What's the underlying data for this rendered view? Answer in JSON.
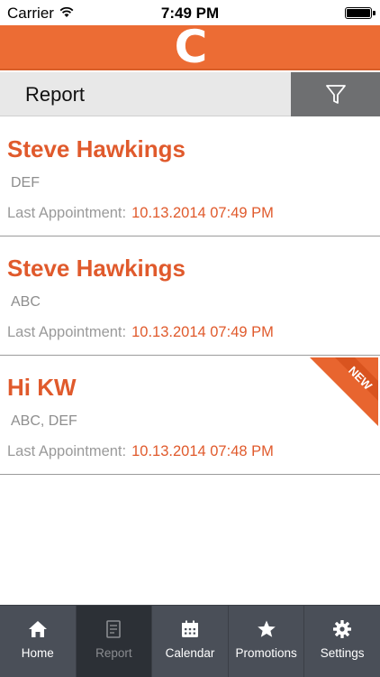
{
  "status_bar": {
    "carrier": "Carrier",
    "time": "7:49 PM",
    "battery_level": 1.0
  },
  "brand": {
    "logo_text": "C",
    "color": "#ec6c34"
  },
  "header": {
    "title": "Report",
    "filter_icon": "filter-icon"
  },
  "records": [
    {
      "name": "Steve Hawkings",
      "tags": "DEF",
      "appt_label": "Last Appointment:",
      "appt_value": "10.13.2014 07:49 PM"
    },
    {
      "name": "Steve Hawkings",
      "tags": "ABC",
      "appt_label": "Last Appointment:",
      "appt_value": "10.13.2014 07:49 PM"
    },
    {
      "name": "Hi KW",
      "tags": "ABC, DEF",
      "appt_label": "Last Appointment:",
      "appt_value": "10.13.2014 07:48 PM",
      "badge": "NEW"
    }
  ],
  "tabs": [
    {
      "label": "Home",
      "icon": "home-icon"
    },
    {
      "label": "Report",
      "icon": "report-icon",
      "active": true
    },
    {
      "label": "Calendar",
      "icon": "calendar-icon"
    },
    {
      "label": "Promotions",
      "icon": "star-icon"
    },
    {
      "label": "Settings",
      "icon": "gear-icon"
    }
  ],
  "colors": {
    "accent": "#e05a2c",
    "tab_bar": "#4a4f58",
    "tab_active": "#2c3036"
  }
}
